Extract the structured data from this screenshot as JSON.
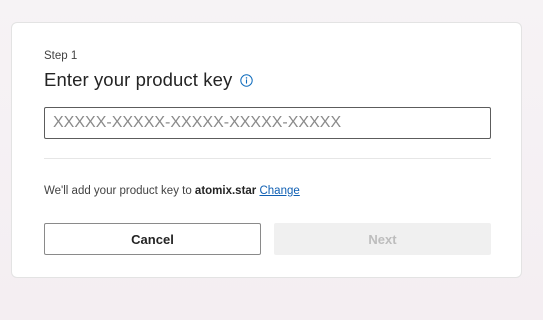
{
  "step": {
    "label": "Step 1"
  },
  "dialog": {
    "title": "Enter your product key",
    "info_icon": "info-icon"
  },
  "product_key": {
    "value": "",
    "placeholder": "XXXXX-XXXXX-XXXXX-XXXXX-XXXXX"
  },
  "note": {
    "prefix": "We'll add your product key to ",
    "domain": "atomix.star",
    "change_label": "Change"
  },
  "buttons": {
    "cancel": "Cancel",
    "next": "Next"
  },
  "colors": {
    "link": "#0f5fb3",
    "info_icon": "#0f6cbd",
    "disabled_bg": "#f0f0f0",
    "disabled_text": "#bdbdbd"
  }
}
